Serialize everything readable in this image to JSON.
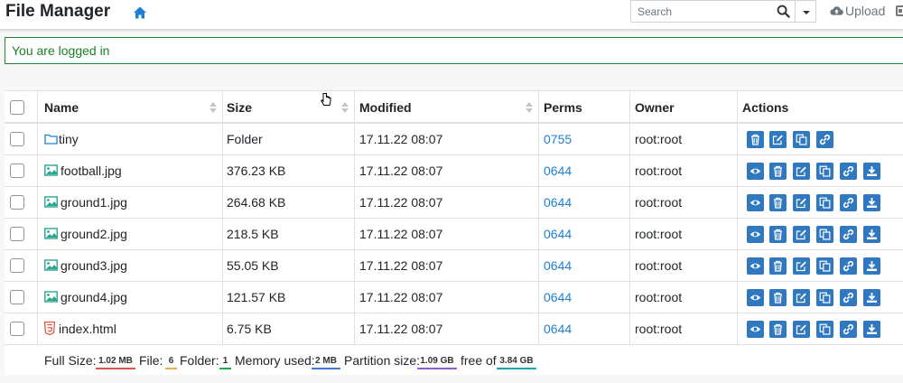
{
  "header": {
    "brand": "File Manager",
    "search_placeholder": "Search",
    "upload_label": "Upload"
  },
  "alert": {
    "message": "You are logged in"
  },
  "table": {
    "columns": {
      "name": "Name",
      "size": "Size",
      "modified": "Modified",
      "perms": "Perms",
      "owner": "Owner",
      "actions": "Actions"
    },
    "rows": [
      {
        "name": "tiny",
        "type": "folder",
        "size": "Folder",
        "modified": "17.11.22 08:07",
        "perms": "0755",
        "owner": "root:root"
      },
      {
        "name": "football.jpg",
        "type": "image",
        "size": "376.23 KB",
        "modified": "17.11.22 08:07",
        "perms": "0644",
        "owner": "root:root"
      },
      {
        "name": "ground1.jpg",
        "type": "image",
        "size": "264.68 KB",
        "modified": "17.11.22 08:07",
        "perms": "0644",
        "owner": "root:root"
      },
      {
        "name": "ground2.jpg",
        "type": "image",
        "size": "218.5 KB",
        "modified": "17.11.22 08:07",
        "perms": "0644",
        "owner": "root:root"
      },
      {
        "name": "ground3.jpg",
        "type": "image",
        "size": "55.05 KB",
        "modified": "17.11.22 08:07",
        "perms": "0644",
        "owner": "root:root"
      },
      {
        "name": "ground4.jpg",
        "type": "image",
        "size": "121.57 KB",
        "modified": "17.11.22 08:07",
        "perms": "0644",
        "owner": "root:root"
      },
      {
        "name": "index.html",
        "type": "html",
        "size": "6.75 KB",
        "modified": "17.11.22 08:07",
        "perms": "0644",
        "owner": "root:root"
      }
    ]
  },
  "footer": {
    "full_size_label": "Full Size:",
    "full_size_value": "1.02 MB",
    "file_label": "File:",
    "file_value": "6",
    "folder_label": "Folder:",
    "folder_value": "1",
    "memory_label": "Memory used:",
    "memory_value": "2 MB",
    "partition_label": "Partition size:",
    "partition_value": "1.09 GB",
    "free_label": "free of",
    "free_value": "3.84 GB"
  },
  "colors": {
    "accent": "#3078c0",
    "link": "#1f7fd0",
    "success": "#1a7e27",
    "badge_full_size": "#d9534f",
    "badge_file": "#f0ad4e",
    "badge_folder": "#28a745",
    "badge_memory": "#3b7ddd",
    "badge_partition": "#8e5cd9",
    "badge_free": "#17a2b8"
  }
}
